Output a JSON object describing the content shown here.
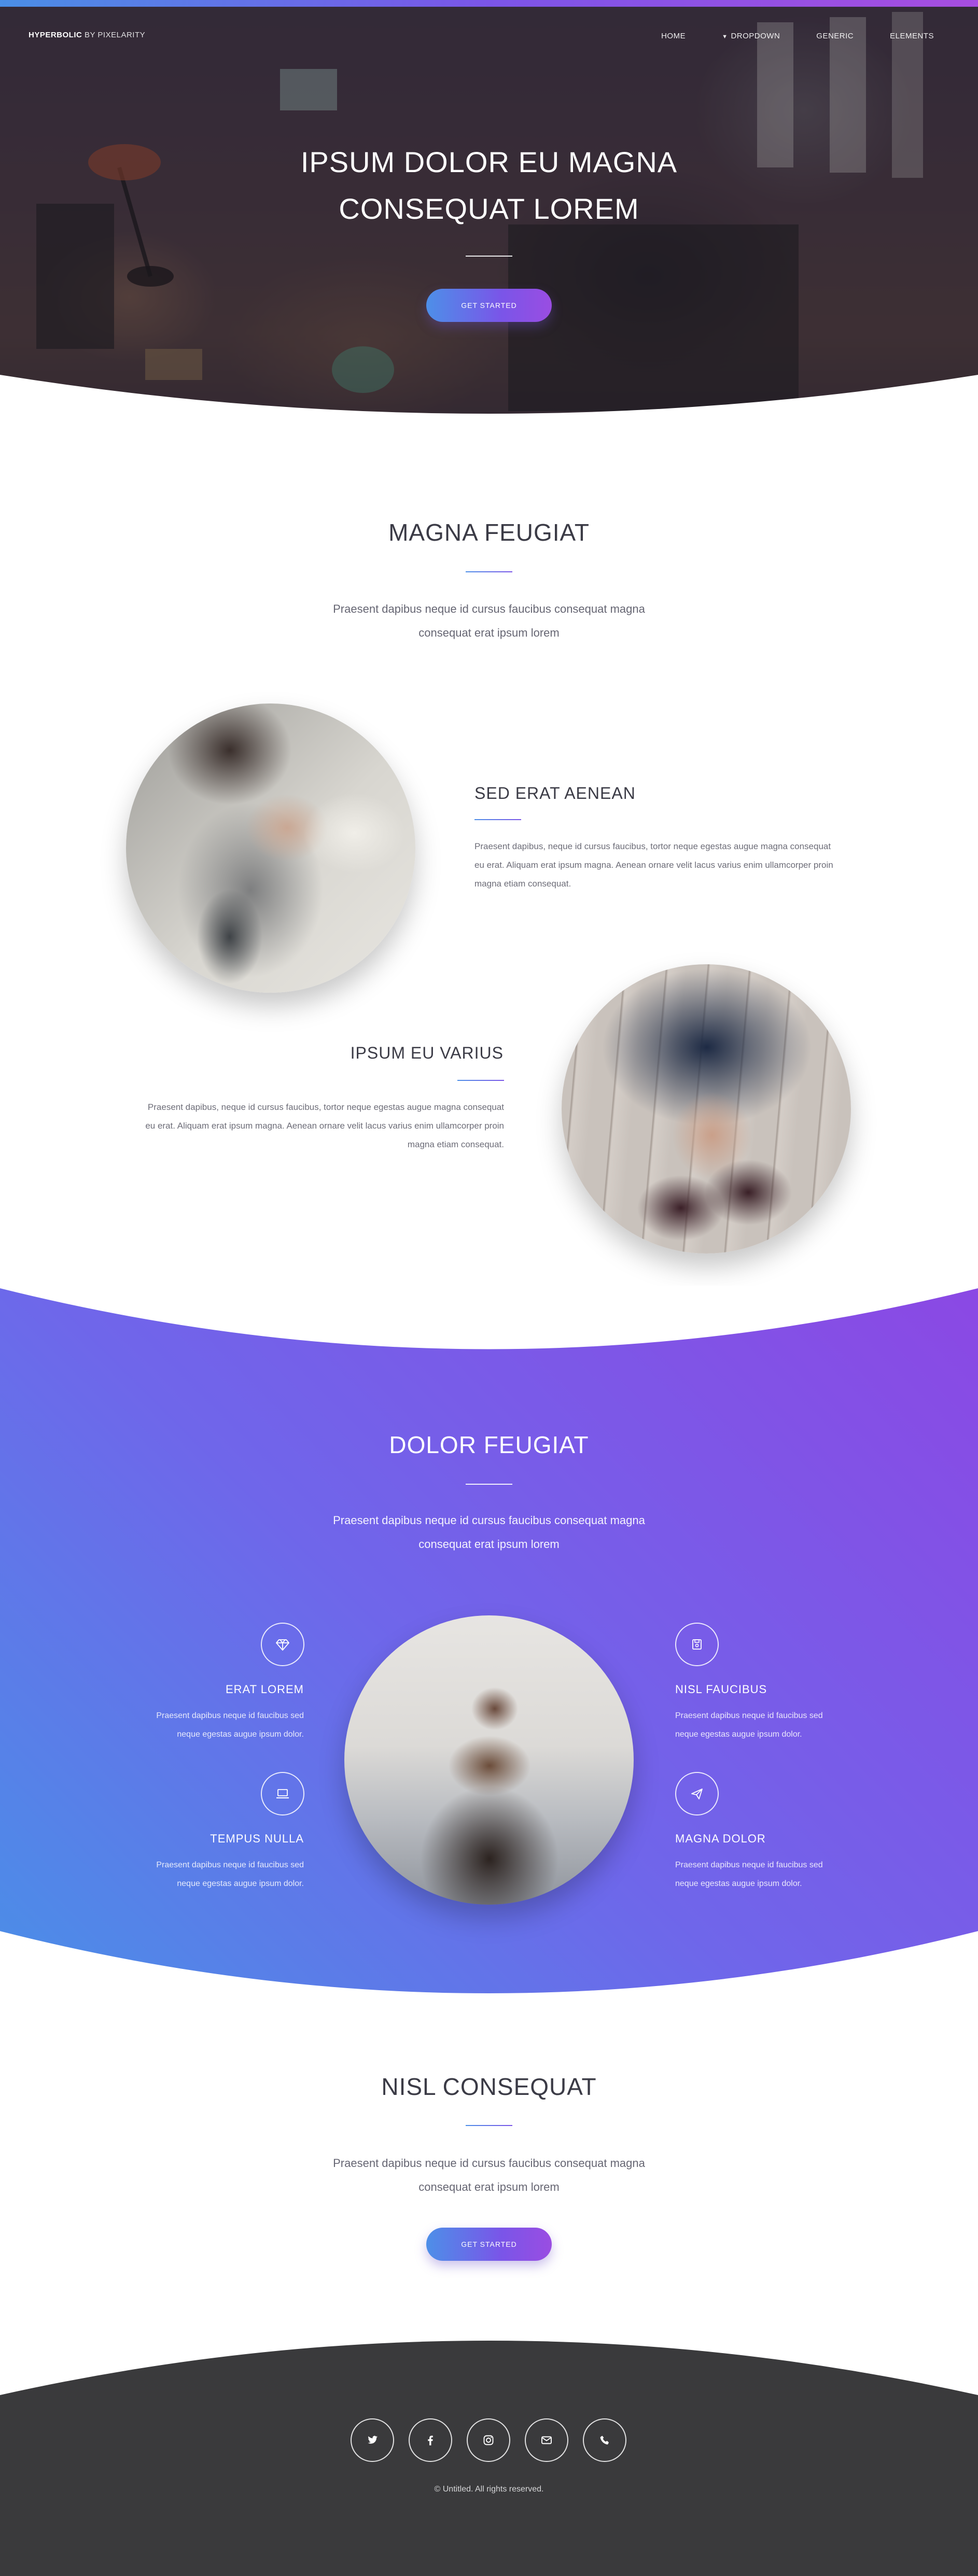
{
  "header": {
    "brand_strong": "HYPERBOLIC",
    "brand_rest": " BY PIXELARITY",
    "nav": [
      {
        "label": "HOME"
      },
      {
        "label": "DROPDOWN",
        "icon": "chevron-down-icon"
      },
      {
        "label": "GENERIC"
      },
      {
        "label": "ELEMENTS"
      }
    ]
  },
  "hero": {
    "title": "IPSUM DOLOR EU MAGNA CONSEQUAT LOREM",
    "button": "GET STARTED"
  },
  "intro": {
    "title": "MAGNA FEUGIAT",
    "text": "Praesent dapibus neque id cursus faucibus consequat magna consequat erat ipsum lorem"
  },
  "features": [
    {
      "title": "SED ERAT AENEAN",
      "text": "Praesent dapibus, neque id cursus faucibus, tortor neque egestas augue magna consequat eu erat. Aliquam erat ipsum magna. Aenean ornare velit lacus varius enim ullamcorper proin magna etiam consequat."
    },
    {
      "title": "IPSUM EU VARIUS",
      "text": "Praesent dapibus, neque id cursus faucibus, tortor neque egestas augue magna consequat eu erat. Aliquam erat ipsum magna. Aenean ornare velit lacus varius enim ullamcorper proin magna etiam consequat."
    }
  ],
  "gradient_section": {
    "title": "DOLOR FEUGIAT",
    "text": "Praesent dapibus neque id cursus faucibus consequat magna consequat erat ipsum lorem",
    "items": [
      {
        "title": "ERAT LOREM",
        "text": "Praesent dapibus neque id faucibus sed neque egestas augue ipsum dolor.",
        "icon": "diamond-icon"
      },
      {
        "title": "TEMPUS NULLA",
        "text": "Praesent dapibus neque id faucibus sed neque egestas augue ipsum dolor.",
        "icon": "laptop-icon"
      },
      {
        "title": "NISL FAUCIBUS",
        "text": "Praesent dapibus neque id faucibus sed neque egestas augue ipsum dolor.",
        "icon": "save-icon"
      },
      {
        "title": "MAGNA DOLOR",
        "text": "Praesent dapibus neque id faucibus sed neque egestas augue ipsum dolor.",
        "icon": "paper-plane-icon"
      }
    ]
  },
  "cta": {
    "title": "NISL CONSEQUAT",
    "text": "Praesent dapibus neque id cursus faucibus consequat magna consequat erat ipsum lorem",
    "button": "GET STARTED"
  },
  "footer": {
    "socials": [
      "twitter-icon",
      "facebook-icon",
      "instagram-icon",
      "email-icon",
      "phone-icon"
    ],
    "copyright": "© Untitled. All rights reserved."
  },
  "colors": {
    "gradient_start": "#4a8fe7",
    "gradient_end": "#8b48e4",
    "footer_bg": "#3a3a3c"
  }
}
